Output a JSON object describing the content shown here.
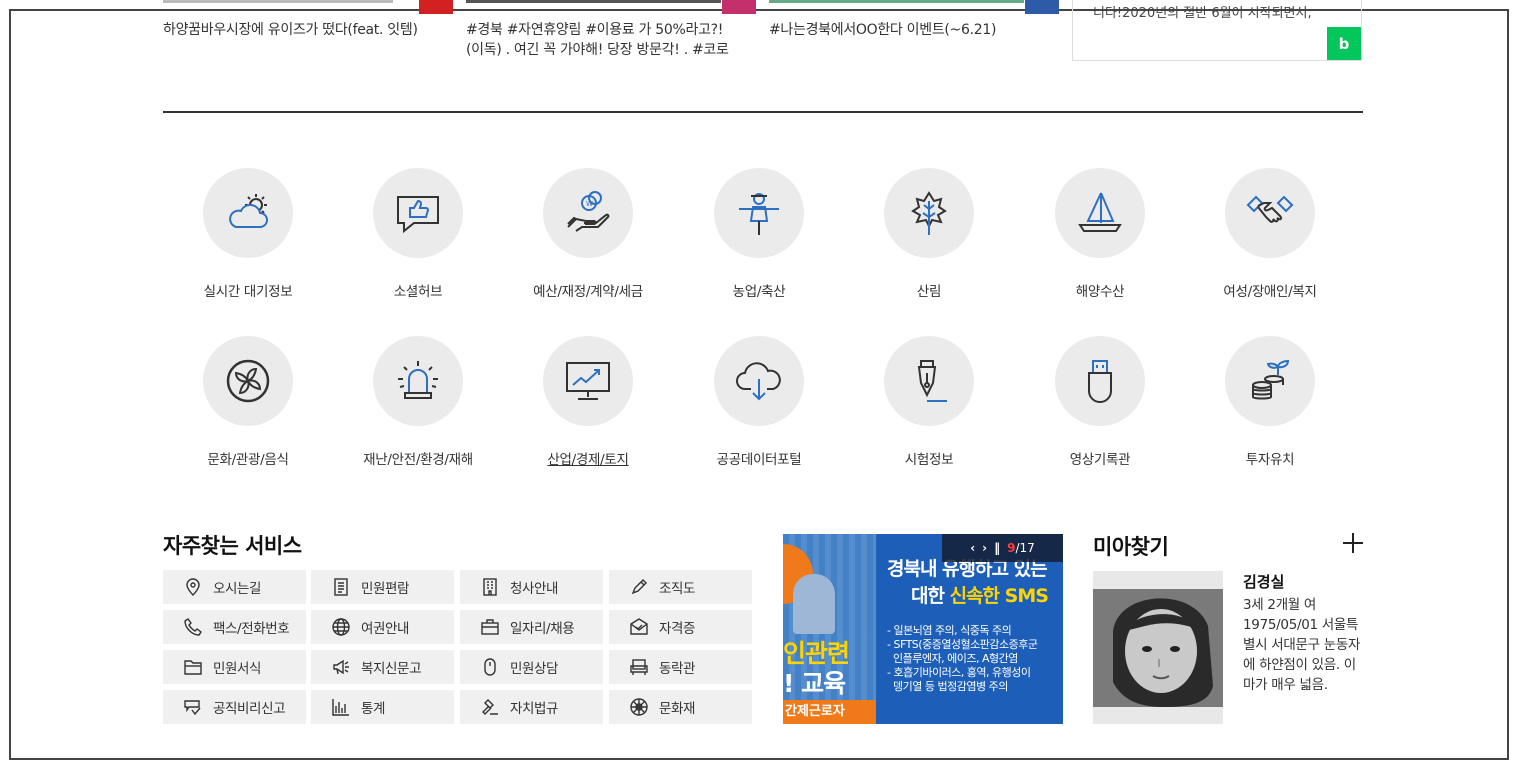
{
  "top_cards": [
    {
      "caption": "하양꿈바우시장에 유이즈가 떴다(feat. 잇템)",
      "source_color": "#d32020"
    },
    {
      "caption": "#경북 #자연휴양림 #이용료 가 50%라고?!",
      "caption2": "(이독) . 여긴 꼭 가야해! 당장 방문각! . #코로",
      "source_color": "#c4306b"
    },
    {
      "caption": "#나는경북에서OO한다 이벤트(~6.21)",
      "source_color": "#2d5ba8"
    }
  ],
  "blog": {
    "text": "니다!2020년의 절반 6월이 시작되면서,",
    "badge": "b"
  },
  "categories": [
    {
      "label": "실시간 대기정보",
      "icon": "weather-cloud-sun-icon"
    },
    {
      "label": "소셜허브",
      "icon": "thumbs-up-chat-icon"
    },
    {
      "label": "예산/재정/계약/세금",
      "icon": "hand-coin-icon"
    },
    {
      "label": "농업/축산",
      "icon": "scarecrow-icon"
    },
    {
      "label": "산림",
      "icon": "leaf-icon"
    },
    {
      "label": "해양수산",
      "icon": "sailboat-icon"
    },
    {
      "label": "여성/장애인/복지",
      "icon": "handshake-icon"
    },
    {
      "label": "문화/관광/음식",
      "icon": "pinwheel-icon"
    },
    {
      "label": "재난/안전/환경/재해",
      "icon": "siren-icon"
    },
    {
      "label": "산업/경제/토지",
      "icon": "monitor-chart-icon"
    },
    {
      "label": "공공데이터포털",
      "icon": "cloud-download-icon"
    },
    {
      "label": "시험정보",
      "icon": "fountain-pen-icon"
    },
    {
      "label": "영상기록관",
      "icon": "usb-drive-icon"
    },
    {
      "label": "투자유치",
      "icon": "coins-sprout-icon"
    }
  ],
  "services": {
    "title": "자주찾는 서비스",
    "items": [
      {
        "label": "오시는길",
        "icon": "location-pin-icon"
      },
      {
        "label": "민원편람",
        "icon": "document-list-icon"
      },
      {
        "label": "청사안내",
        "icon": "building-icon"
      },
      {
        "label": "조직도",
        "icon": "org-pencil-icon"
      },
      {
        "label": "팩스/전화번호",
        "icon": "phone-icon"
      },
      {
        "label": "여권안내",
        "icon": "globe-icon"
      },
      {
        "label": "일자리/채용",
        "icon": "briefcase-icon"
      },
      {
        "label": "자격증",
        "icon": "certificate-icon"
      },
      {
        "label": "민원서식",
        "icon": "folder-icon"
      },
      {
        "label": "복지신문고",
        "icon": "megaphone-icon"
      },
      {
        "label": "민원상담",
        "icon": "mouse-icon"
      },
      {
        "label": "동락관",
        "icon": "theater-icon"
      },
      {
        "label": "공직비리신고",
        "icon": "report-icon"
      },
      {
        "label": "통계",
        "icon": "bar-chart-icon"
      },
      {
        "label": "자치법규",
        "icon": "gavel-icon"
      },
      {
        "label": "문화재",
        "icon": "heritage-icon"
      }
    ]
  },
  "banner": {
    "headline1": "경북내 유행하고 있는",
    "headline2_pre": "대한 ",
    "headline2_em": "신속한 SMS",
    "items": [
      "- 일본뇌염 주의, 식중독 주의",
      "- SFTS(중증열성혈소판감소증후군",
      "  인플루엔자, 에이즈, A형간염",
      "- 호흡기바이러스, 홍역, 유행성이",
      "  뎅기열 등 법정감염병 주의"
    ],
    "left_big1": "인관련",
    "left_big2": "! 교육",
    "left_tag": "간제근로자",
    "current": "9",
    "total": "/17"
  },
  "missing_child": {
    "title": "미아찾기",
    "name": "김경실",
    "description": "3세 2개월 여 1975/05/01 서울특별시 서대문구 눈동자에 하얀점이 있음. 이마가 매우 넓음."
  }
}
